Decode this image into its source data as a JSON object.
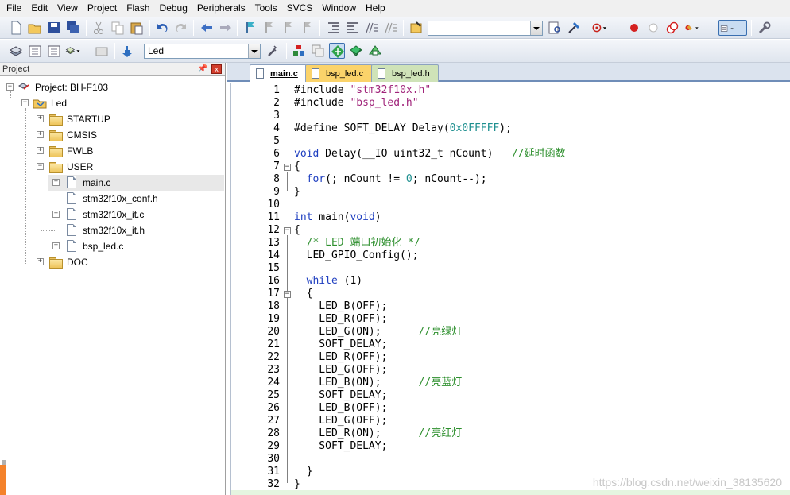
{
  "menu": [
    "File",
    "Edit",
    "View",
    "Project",
    "Flash",
    "Debug",
    "Peripherals",
    "Tools",
    "SVCS",
    "Window",
    "Help"
  ],
  "toolbar2": {
    "target_select": "Led"
  },
  "project_panel": {
    "title": "Project",
    "tree": {
      "root": "Project: BH-F103",
      "target": "Led",
      "groups": [
        "STARTUP",
        "CMSIS",
        "FWLB",
        "USER"
      ],
      "user_files": [
        "main.c",
        "stm32f10x_conf.h",
        "stm32f10x_it.c",
        "stm32f10x_it.h",
        "bsp_led.c"
      ],
      "doc": "DOC"
    }
  },
  "tabs": [
    "main.c",
    "bsp_led.c",
    "bsp_led.h"
  ],
  "colors": {
    "keyword": "#1f3fc0",
    "string": "#a0247a",
    "comment": "#2d8f2d",
    "number": "#1d8f8f"
  },
  "code": {
    "line_numbers": [
      "1",
      "2",
      "3",
      "4",
      "5",
      "6",
      "7",
      "8",
      "9",
      "10",
      "11",
      "12",
      "13",
      "14",
      "15",
      "16",
      "17",
      "18",
      "19",
      "20",
      "21",
      "22",
      "23",
      "24",
      "25",
      "26",
      "27",
      "28",
      "29",
      "30",
      "31",
      "32"
    ],
    "l1": {
      "a": "#include ",
      "b": "\"stm32f10x.h\""
    },
    "l2": {
      "a": "#include ",
      "b": "\"bsp_led.h\""
    },
    "l4": {
      "a": "#define SOFT_DELAY Delay(",
      "b": "0x0FFFFF",
      "c": ");"
    },
    "l6": {
      "a": "void",
      "b": " Delay(__IO uint32_t nCount)   ",
      "c": "//延时函数"
    },
    "l7": "{",
    "l8": {
      "a": "  ",
      "b": "for",
      "c": "(; nCount != ",
      "d": "0",
      "e": "; nCount--);"
    },
    "l9": "}",
    "l11": {
      "a": "int",
      "b": " main(",
      "c": "void",
      "d": ")"
    },
    "l12": "{",
    "l13": "  /* LED 端口初始化 */",
    "l14": "  LED_GPIO_Config();",
    "l16": {
      "a": "  ",
      "b": "while",
      "c": " (1)"
    },
    "l17": "  {",
    "l18": "    LED_B(OFF);",
    "l19": "    LED_R(OFF);",
    "l20": {
      "a": "    LED_G(ON);      ",
      "b": "//亮绿灯"
    },
    "l21": "    SOFT_DELAY;",
    "l22": "    LED_R(OFF);",
    "l23": "    LED_G(OFF);",
    "l24": {
      "a": "    LED_B(ON);      ",
      "b": "//亮蓝灯"
    },
    "l25": "    SOFT_DELAY;",
    "l26": "    LED_B(OFF);",
    "l27": "    LED_G(OFF);",
    "l28": {
      "a": "    LED_R(ON);      ",
      "b": "//亮红灯"
    },
    "l29": "    SOFT_DELAY;",
    "l31": "  }",
    "l32": "}"
  },
  "watermark": "https://blog.csdn.net/weixin_38135620"
}
